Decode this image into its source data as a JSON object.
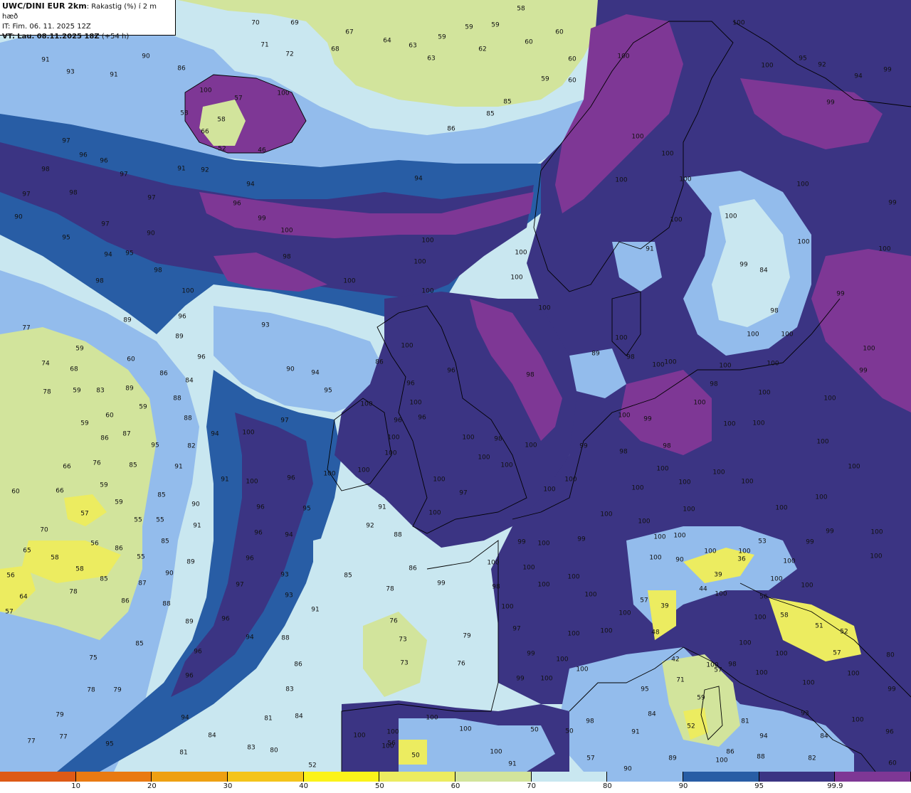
{
  "header": {
    "model": "UWC/DINI EUR 2km",
    "variable": ": Rakastig (%) í 2 m hæð",
    "initial_time": "IT: Fim. 06. 11. 2025 12Z",
    "valid_prefix": "VT:",
    "valid_time": "Lau. 08.11.2025 18Z",
    "lead_time": "(+54 h)"
  },
  "colors": {
    "c_lt10": "#dd5a16",
    "c_10": "#e97a12",
    "c_20": "#eea012",
    "c_30": "#f4c41b",
    "c_40": "#fbf31a",
    "c_50": "#ecec60",
    "c_60": "#d2e49c",
    "c_70": "#c9e7f0",
    "c_80": "#93bcec",
    "c_90": "#285da5",
    "c_95": "#3b3483",
    "c_999": "#7e3795",
    "land_outline": "#000000"
  },
  "legend": {
    "colors": [
      "#dd5a16",
      "#e97a12",
      "#eea012",
      "#f4c41b",
      "#fbf31a",
      "#ecec60",
      "#d2e49c",
      "#c9e7f0",
      "#93bcec",
      "#285da5",
      "#3b3483",
      "#7e3795"
    ],
    "labels": [
      "10",
      "20",
      "30",
      "40",
      "50",
      "60",
      "70",
      "80",
      "90",
      "95",
      "99.9"
    ]
  },
  "values": [
    [
      "58",
      732,
      13
    ],
    [
      "70",
      359,
      33
    ],
    [
      "69",
      414,
      33
    ],
    [
      "67",
      491,
      46
    ],
    [
      "59",
      659,
      39
    ],
    [
      "59",
      696,
      36
    ],
    [
      "60",
      786,
      46
    ],
    [
      "64",
      544,
      58
    ],
    [
      "63",
      580,
      65
    ],
    [
      "59",
      621,
      53
    ],
    [
      "62",
      678,
      70
    ],
    [
      "60",
      743,
      60
    ],
    [
      "68",
      471,
      70
    ],
    [
      "71",
      372,
      64
    ],
    [
      "72",
      407,
      77
    ],
    [
      "63",
      606,
      83
    ],
    [
      "60",
      804,
      84
    ],
    [
      "59",
      766,
      112
    ],
    [
      "60",
      804,
      114
    ],
    [
      "90",
      205,
      80
    ],
    [
      "91",
      64,
      85
    ],
    [
      "93",
      99,
      102
    ],
    [
      "91",
      160,
      106
    ],
    [
      "86",
      255,
      97
    ],
    [
      "100",
      289,
      128
    ],
    [
      "57",
      335,
      139
    ],
    [
      "100",
      398,
      132
    ],
    [
      "58",
      259,
      160
    ],
    [
      "58",
      311,
      169
    ],
    [
      "66",
      288,
      186
    ],
    [
      "52",
      312,
      210
    ],
    [
      "46",
      368,
      212
    ],
    [
      "85",
      713,
      144
    ],
    [
      "85",
      689,
      161
    ],
    [
      "86",
      634,
      182
    ],
    [
      "97",
      93,
      199
    ],
    [
      "96",
      117,
      219
    ],
    [
      "96",
      146,
      227
    ],
    [
      "97",
      174,
      246
    ],
    [
      "98",
      64,
      239
    ],
    [
      "98",
      103,
      272
    ],
    [
      "97",
      37,
      274
    ],
    [
      "91",
      255,
      238
    ],
    [
      "92",
      288,
      240
    ],
    [
      "94",
      352,
      260
    ],
    [
      "94",
      588,
      252
    ],
    [
      "97",
      213,
      279
    ],
    [
      "96",
      333,
      287
    ],
    [
      "99",
      368,
      308
    ],
    [
      "100",
      403,
      325
    ],
    [
      "90",
      26,
      306
    ],
    [
      "97",
      148,
      316
    ],
    [
      "90",
      212,
      329
    ],
    [
      "95",
      93,
      335
    ],
    [
      "94",
      152,
      359
    ],
    [
      "95",
      182,
      357
    ],
    [
      "98",
      403,
      362
    ],
    [
      "98",
      222,
      381
    ],
    [
      "100",
      601,
      339
    ],
    [
      "100",
      491,
      396
    ],
    [
      "100",
      590,
      369
    ],
    [
      "100",
      732,
      356
    ],
    [
      "100",
      726,
      391
    ],
    [
      "98",
      140,
      396
    ],
    [
      "100",
      264,
      410
    ],
    [
      "100",
      601,
      410
    ],
    [
      "100",
      765,
      434
    ],
    [
      "96",
      256,
      446
    ],
    [
      "89",
      179,
      451
    ],
    [
      "93",
      373,
      458
    ],
    [
      "77",
      37,
      462
    ],
    [
      "89",
      252,
      474
    ],
    [
      "59",
      112,
      491
    ],
    [
      "74",
      64,
      512
    ],
    [
      "60",
      184,
      506
    ],
    [
      "86",
      533,
      510
    ],
    [
      "90",
      408,
      520
    ],
    [
      "94",
      443,
      525
    ],
    [
      "86",
      230,
      526
    ],
    [
      "84",
      266,
      536
    ],
    [
      "68",
      104,
      520
    ],
    [
      "78",
      66,
      552
    ],
    [
      "59",
      108,
      550
    ],
    [
      "83",
      141,
      550
    ],
    [
      "89",
      182,
      547
    ],
    [
      "88",
      249,
      561
    ],
    [
      "96",
      283,
      503
    ],
    [
      "100",
      572,
      487
    ],
    [
      "100",
      584,
      567
    ],
    [
      "98",
      745,
      528
    ],
    [
      "96",
      577,
      540
    ],
    [
      "95",
      461,
      550
    ],
    [
      "96",
      634,
      522
    ],
    [
      "60",
      154,
      585
    ],
    [
      "59",
      201,
      573
    ],
    [
      "59",
      119,
      596
    ],
    [
      "88",
      264,
      589
    ],
    [
      "97",
      400,
      592
    ],
    [
      "100",
      515,
      569
    ],
    [
      "94",
      302,
      611
    ],
    [
      "100",
      349,
      609
    ],
    [
      "96",
      559,
      592
    ],
    [
      "96",
      593,
      588
    ],
    [
      "86",
      147,
      617
    ],
    [
      "87",
      178,
      611
    ],
    [
      "95",
      218,
      627
    ],
    [
      "82",
      269,
      628
    ],
    [
      "100",
      553,
      616
    ],
    [
      "100",
      549,
      638
    ],
    [
      "100",
      658,
      616
    ],
    [
      "100",
      746,
      627
    ],
    [
      "100",
      511,
      662
    ],
    [
      "98",
      700,
      618
    ],
    [
      "66",
      94,
      657
    ],
    [
      "76",
      136,
      652
    ],
    [
      "85",
      187,
      655
    ],
    [
      "91",
      251,
      657
    ],
    [
      "100",
      463,
      667
    ],
    [
      "96",
      409,
      673
    ],
    [
      "100",
      354,
      678
    ],
    [
      "91",
      316,
      675
    ],
    [
      "60",
      22,
      692
    ],
    [
      "66",
      84,
      691
    ],
    [
      "59",
      146,
      683
    ],
    [
      "85",
      227,
      697
    ],
    [
      "100",
      617,
      675
    ],
    [
      "100",
      712,
      655
    ],
    [
      "100",
      680,
      644
    ],
    [
      "97",
      651,
      694
    ],
    [
      "90",
      275,
      710
    ],
    [
      "57",
      119,
      723
    ],
    [
      "59",
      167,
      707
    ],
    [
      "55",
      194,
      732
    ],
    [
      "55",
      225,
      732
    ],
    [
      "96",
      366,
      714
    ],
    [
      "95",
      431,
      716
    ],
    [
      "91",
      537,
      714
    ],
    [
      "100",
      611,
      722
    ],
    [
      "91",
      277,
      740
    ],
    [
      "70",
      62,
      746
    ],
    [
      "92",
      520,
      740
    ],
    [
      "94",
      406,
      753
    ],
    [
      "96",
      363,
      750
    ],
    [
      "88",
      559,
      753
    ],
    [
      "56",
      133,
      765
    ],
    [
      "86",
      167,
      772
    ],
    [
      "85",
      232,
      762
    ],
    [
      "65",
      38,
      775
    ],
    [
      "58",
      77,
      785
    ],
    [
      "55",
      198,
      784
    ],
    [
      "89",
      268,
      791
    ],
    [
      "96",
      351,
      786
    ],
    [
      "58",
      112,
      801
    ],
    [
      "90",
      238,
      807
    ],
    [
      "85",
      146,
      815
    ],
    [
      "93",
      400,
      809
    ],
    [
      "85",
      489,
      810
    ],
    [
      "86",
      580,
      800
    ],
    [
      "99",
      620,
      821
    ],
    [
      "56",
      15,
      810
    ],
    [
      "87",
      200,
      821
    ],
    [
      "78",
      103,
      833
    ],
    [
      "64",
      33,
      840
    ],
    [
      "86",
      176,
      846
    ],
    [
      "88",
      234,
      850
    ],
    [
      "97",
      337,
      823
    ],
    [
      "93",
      406,
      838
    ],
    [
      "78",
      548,
      829
    ],
    [
      "57",
      13,
      861
    ],
    [
      "91",
      443,
      858
    ],
    [
      "89",
      266,
      875
    ],
    [
      "96",
      317,
      871
    ],
    [
      "76",
      553,
      874
    ],
    [
      "94",
      351,
      897
    ],
    [
      "88",
      401,
      898
    ],
    [
      "73",
      566,
      900
    ],
    [
      "79",
      656,
      895
    ],
    [
      "85",
      196,
      906
    ],
    [
      "96",
      278,
      917
    ],
    [
      "75",
      131,
      926
    ],
    [
      "86",
      419,
      935
    ],
    [
      "73",
      568,
      933
    ],
    [
      "76",
      648,
      934
    ],
    [
      "96",
      266,
      951
    ],
    [
      "78",
      128,
      971
    ],
    [
      "79",
      165,
      971
    ],
    [
      "83",
      407,
      970
    ],
    [
      "94",
      260,
      1010
    ],
    [
      "81",
      377,
      1011
    ],
    [
      "84",
      420,
      1008
    ],
    [
      "79",
      84,
      1006
    ],
    [
      "77",
      89,
      1037
    ],
    [
      "77",
      44,
      1043
    ],
    [
      "84",
      298,
      1035
    ],
    [
      "95",
      154,
      1047
    ],
    [
      "83",
      353,
      1052
    ],
    [
      "81",
      258,
      1059
    ],
    [
      "80",
      385,
      1056
    ],
    [
      "52",
      439,
      1077
    ],
    [
      "100",
      1038,
      33
    ],
    [
      "100",
      1078,
      93
    ],
    [
      "95",
      1128,
      83
    ],
    [
      "92",
      1155,
      92
    ],
    [
      "99",
      1247,
      99
    ],
    [
      "94",
      1206,
      108
    ],
    [
      "99",
      1167,
      145
    ],
    [
      "100",
      876,
      80
    ],
    [
      "100",
      896,
      193
    ],
    [
      "100",
      938,
      217
    ],
    [
      "100",
      873,
      254
    ],
    [
      "100",
      963,
      253
    ],
    [
      "100",
      1128,
      260
    ],
    [
      "99",
      1254,
      286
    ],
    [
      "100",
      950,
      310
    ],
    [
      "100",
      1027,
      305
    ],
    [
      "100",
      1129,
      341
    ],
    [
      "100",
      1243,
      351
    ],
    [
      "91",
      913,
      351
    ],
    [
      "99",
      1045,
      373
    ],
    [
      "84",
      1073,
      381
    ],
    [
      "98",
      1088,
      438
    ],
    [
      "99",
      1181,
      414
    ],
    [
      "100",
      1221,
      491
    ],
    [
      "100",
      1058,
      471
    ],
    [
      "100",
      1106,
      471
    ],
    [
      "100",
      1019,
      515
    ],
    [
      "100",
      1086,
      512
    ],
    [
      "99",
      1213,
      522
    ],
    [
      "100",
      1074,
      553
    ],
    [
      "100",
      1166,
      561
    ],
    [
      "98",
      1003,
      541
    ],
    [
      "89",
      837,
      498
    ],
    [
      "100",
      873,
      476
    ],
    [
      "98",
      886,
      503
    ],
    [
      "100",
      925,
      514
    ],
    [
      "100",
      942,
      510
    ],
    [
      "100",
      877,
      585
    ],
    [
      "99",
      910,
      590
    ],
    [
      "100",
      983,
      567
    ],
    [
      "100",
      1025,
      597
    ],
    [
      "100",
      1066,
      596
    ],
    [
      "100",
      1156,
      622
    ],
    [
      "99",
      820,
      628
    ],
    [
      "98",
      876,
      636
    ],
    [
      "98",
      937,
      628
    ],
    [
      "100",
      931,
      660
    ],
    [
      "100",
      962,
      679
    ],
    [
      "100",
      1010,
      665
    ],
    [
      "100",
      1200,
      657
    ],
    [
      "100",
      772,
      689
    ],
    [
      "100",
      802,
      675
    ],
    [
      "100",
      896,
      687
    ],
    [
      "100",
      852,
      724
    ],
    [
      "100",
      968,
      717
    ],
    [
      "100",
      1050,
      678
    ],
    [
      "100",
      1098,
      715
    ],
    [
      "100",
      1154,
      700
    ],
    [
      "100",
      1232,
      749
    ],
    [
      "99",
      733,
      763
    ],
    [
      "100",
      764,
      765
    ],
    [
      "99",
      817,
      759
    ],
    [
      "100",
      905,
      734
    ],
    [
      "100",
      927,
      756
    ],
    [
      "100",
      955,
      754
    ],
    [
      "100",
      998,
      776
    ],
    [
      "100",
      1046,
      776
    ],
    [
      "99",
      1166,
      748
    ],
    [
      "99",
      1138,
      763
    ],
    [
      "100",
      1231,
      783
    ],
    [
      "100",
      1109,
      790
    ],
    [
      "53",
      1071,
      762
    ],
    [
      "36",
      1042,
      787
    ],
    [
      "39",
      1009,
      809
    ],
    [
      "44",
      988,
      829
    ],
    [
      "90",
      955,
      788
    ],
    [
      "100",
      921,
      785
    ],
    [
      "100",
      1013,
      836
    ],
    [
      "56",
      1073,
      840
    ],
    [
      "58",
      1102,
      866
    ],
    [
      "51",
      1151,
      881
    ],
    [
      "52",
      1186,
      889
    ],
    [
      "100",
      1091,
      815
    ],
    [
      "100",
      1134,
      824
    ],
    [
      "100",
      1068,
      869
    ],
    [
      "100",
      693,
      792
    ],
    [
      "100",
      743,
      799
    ],
    [
      "100",
      806,
      812
    ],
    [
      "100",
      764,
      823
    ],
    [
      "98",
      697,
      826
    ],
    [
      "100",
      830,
      837
    ],
    [
      "100",
      713,
      854
    ],
    [
      "57",
      905,
      845
    ],
    [
      "39",
      934,
      853
    ],
    [
      "100",
      878,
      863
    ],
    [
      "48",
      921,
      890
    ],
    [
      "97",
      726,
      885
    ],
    [
      "100",
      852,
      888
    ],
    [
      "100",
      1047,
      905
    ],
    [
      "100",
      1098,
      920
    ],
    [
      "100",
      806,
      892
    ],
    [
      "99",
      746,
      920
    ],
    [
      "100",
      790,
      928
    ],
    [
      "100",
      768,
      955
    ],
    [
      "99",
      731,
      955
    ],
    [
      "100",
      818,
      942
    ],
    [
      "100",
      1001,
      936
    ],
    [
      "42",
      949,
      928
    ],
    [
      "57",
      1009,
      943
    ],
    [
      "71",
      956,
      957
    ],
    [
      "95",
      906,
      970
    ],
    [
      "98",
      1029,
      935
    ],
    [
      "100",
      1070,
      947
    ],
    [
      "100",
      1136,
      961
    ],
    [
      "100",
      1199,
      948
    ],
    [
      "99",
      1253,
      970
    ],
    [
      "57",
      1176,
      919
    ],
    [
      "80",
      1251,
      922
    ],
    [
      "59",
      985,
      982
    ],
    [
      "52",
      971,
      1022
    ],
    [
      "81",
      1047,
      1015
    ],
    [
      "93",
      1131,
      1004
    ],
    [
      "84",
      1158,
      1036
    ],
    [
      "96",
      1250,
      1030
    ],
    [
      "91",
      893,
      1030
    ],
    [
      "84",
      916,
      1005
    ],
    [
      "89",
      945,
      1067
    ],
    [
      "86",
      1026,
      1058
    ],
    [
      "88",
      1069,
      1065
    ],
    [
      "82",
      1141,
      1067
    ],
    [
      "100",
      1205,
      1013
    ],
    [
      "94",
      1073,
      1036
    ],
    [
      "100",
      1014,
      1070
    ],
    [
      "100",
      607,
      1010
    ],
    [
      "100",
      654,
      1026
    ],
    [
      "100",
      505,
      1035
    ],
    [
      "100",
      552,
      1030
    ],
    [
      "100",
      545,
      1050
    ],
    [
      "50",
      751,
      1027
    ],
    [
      "50",
      800,
      1029
    ],
    [
      "98",
      829,
      1015
    ],
    [
      "100",
      697,
      1058
    ],
    [
      "91",
      720,
      1075
    ],
    [
      "57",
      830,
      1067
    ],
    [
      "50",
      584,
      1063
    ],
    [
      "56",
      550,
      1046
    ],
    [
      "90",
      882,
      1082
    ],
    [
      "60",
      1254,
      1074
    ]
  ]
}
